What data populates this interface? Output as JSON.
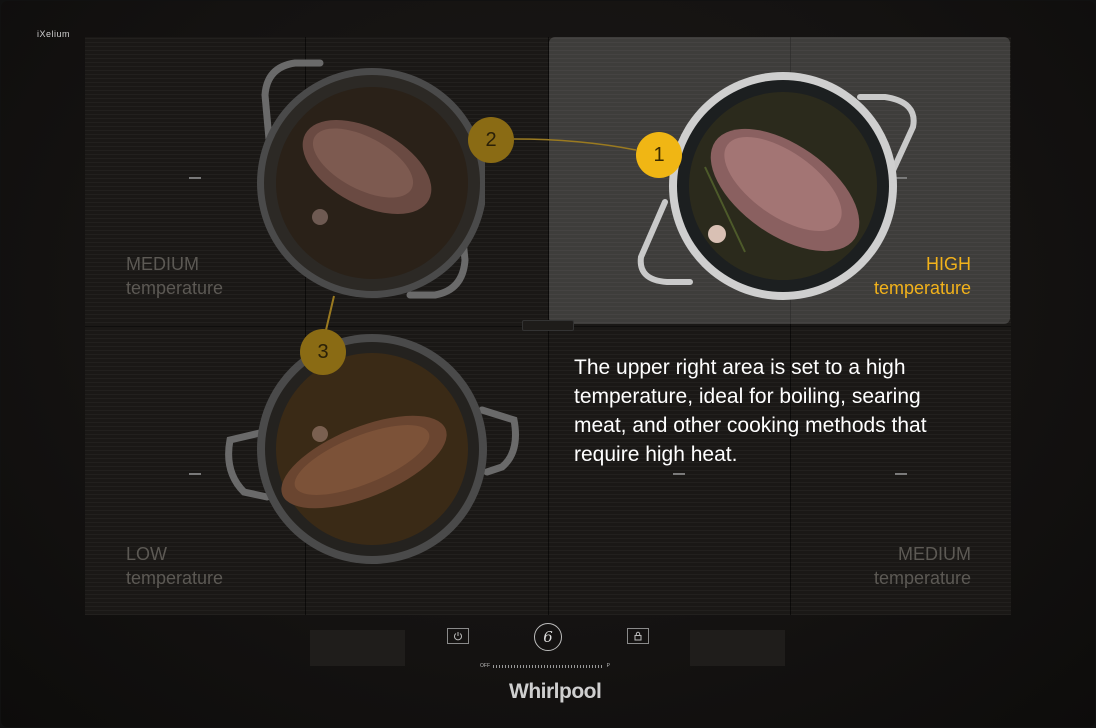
{
  "brand": "iXelium",
  "logo": "Whirlpool",
  "zones": [
    {
      "id": "upper-left",
      "level": "MEDIUM",
      "unit": "temperature",
      "active": false
    },
    {
      "id": "upper-right",
      "level": "HIGH",
      "unit": "temperature",
      "active": true
    },
    {
      "id": "lower-left",
      "level": "LOW",
      "unit": "temperature",
      "active": false
    },
    {
      "id": "lower-right",
      "level": "MEDIUM",
      "unit": "temperature",
      "active": false
    }
  ],
  "steps": [
    "1",
    "2",
    "3"
  ],
  "description": "The upper right area is set to a high temperature, ideal for boiling, searing meat, and other cooking methods that require high heat.",
  "controls": {
    "sixth_sense": "6",
    "slider_min": "OFF",
    "slider_max": "P",
    "power_icon": "power-icon",
    "lock_icon": "lock-icon"
  },
  "colors": {
    "accent": "#f0b614",
    "accent_dim": "#8a6b14",
    "label_dim": "#5c5954"
  }
}
